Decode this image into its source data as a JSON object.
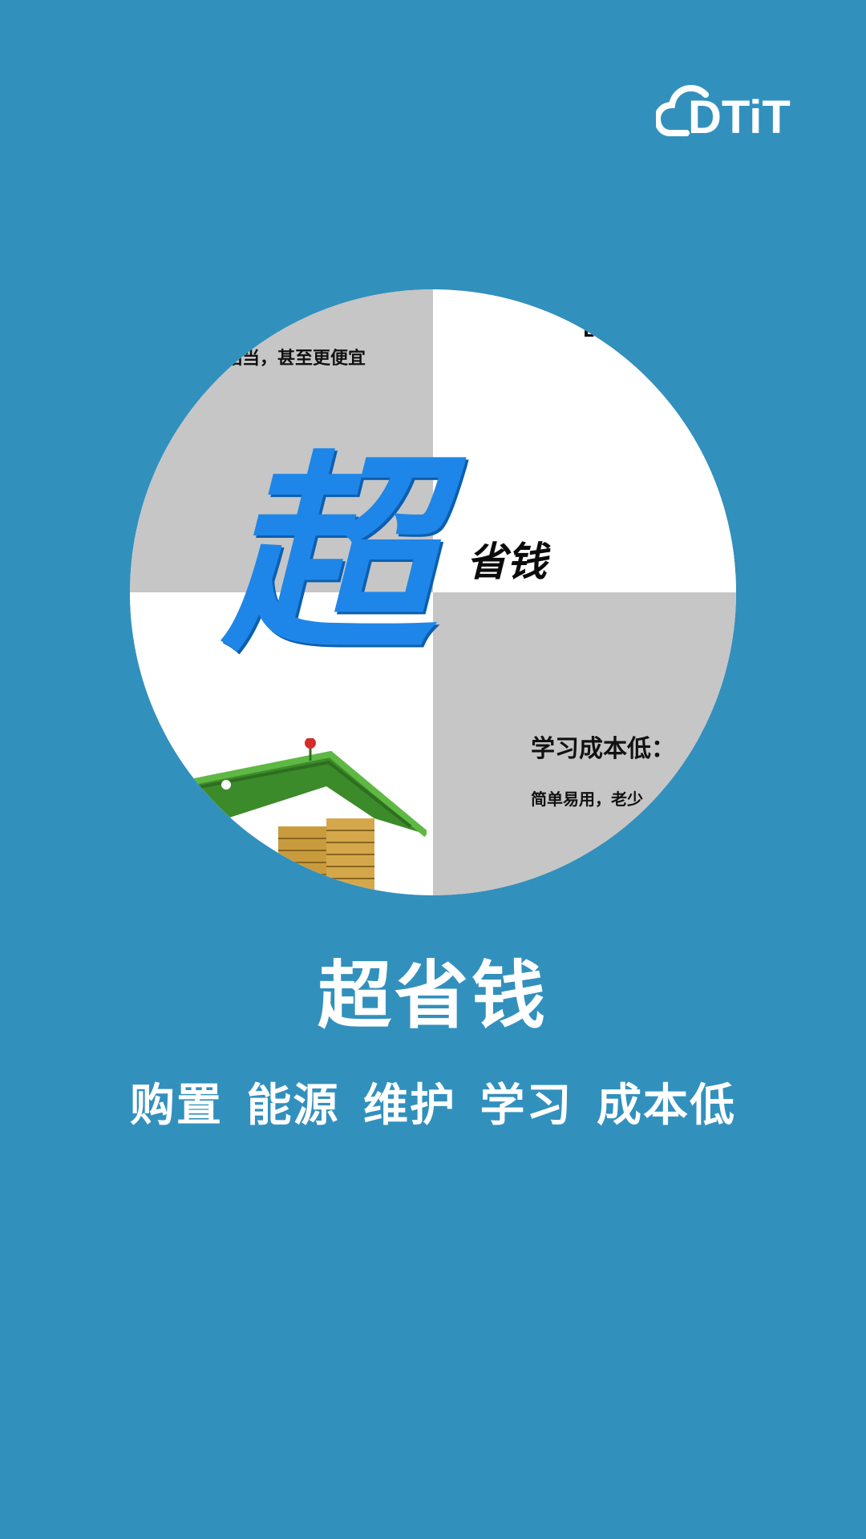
{
  "logo": {
    "text": "DTiT",
    "icon": "cloud-logo-icon"
  },
  "illustration": {
    "top_left_text": "相当，甚至更便宜",
    "top_right_text": "Lt",
    "big_character": "超",
    "small_text": "省钱",
    "bottom_right_heading": "学习成本低：",
    "bottom_right_sub": "简单易用，老少",
    "image_icon": "grass-house-coins-icon"
  },
  "title": "超省钱",
  "subtitle": "购置 能源 维护 学习 成本低",
  "colors": {
    "background": "#3290bd",
    "accent_blue": "#1e86e8"
  }
}
